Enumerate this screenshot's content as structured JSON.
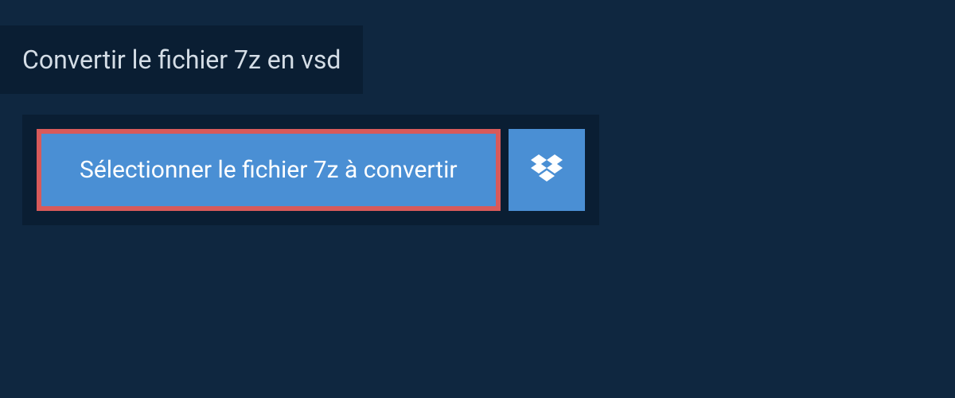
{
  "header": {
    "title": "Convertir le fichier 7z en vsd"
  },
  "upload": {
    "select_file_label": "Sélectionner le fichier 7z à convertir"
  }
}
